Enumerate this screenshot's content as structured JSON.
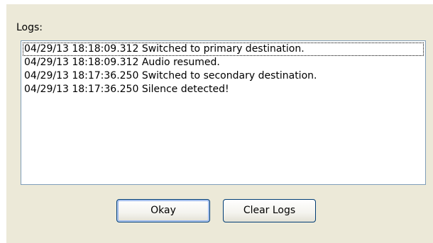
{
  "dialog": {
    "logs_label": "Logs:",
    "logs": [
      "04/29/13 18:18:09.312 Switched to primary destination.",
      "04/29/13 18:18:09.312 Audio resumed.",
      "04/29/13 18:17:36.250 Switched to secondary destination.",
      "04/29/13 18:17:36.250 Silence detected!"
    ],
    "okay_label": "Okay",
    "clear_logs_label": "Clear Logs"
  },
  "colors": {
    "dialog_background": "#ece9d8",
    "list_border": "#7f9db9",
    "button_border": "#003c74"
  }
}
